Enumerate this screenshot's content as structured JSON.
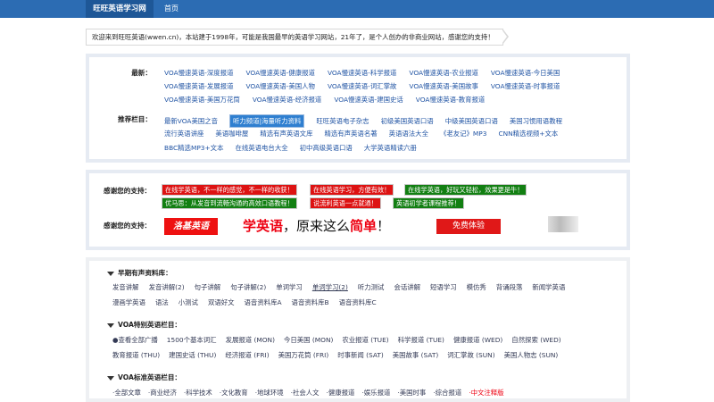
{
  "topbar": {
    "brand": "旺旺英语学习网",
    "home": "首页"
  },
  "welcome": "欢迎来到旺旺英语(wwen.cn)，本站建于1998年，可能是我国最早的英语学习网站，21年了，是个人创办的非商业网站，感谢您的支持！",
  "latest": {
    "label": "最新：",
    "rows": [
      [
        "VOA慢速英语-深度报道",
        "VOA慢速英语-健康报道",
        "VOA慢速英语-科学报道",
        "VOA慢速英语-农业报道",
        "VOA慢速英语-今日美国"
      ],
      [
        "VOA慢速英语-发展报道",
        "VOA慢速英语-美国人物",
        "VOA慢速英语-词汇掌故",
        "VOA慢速英语-美国故事",
        "VOA慢速英语-时事报道"
      ],
      [
        "VOA慢速英语-美国万花筒",
        "VOA慢速英语-经济报道",
        "VOA慢速英语-建国史话",
        "VOA慢速英语-教育报道"
      ]
    ]
  },
  "recommended": {
    "label": "推荐栏目：",
    "rows": [
      [
        "最新VOA美国之音",
        "听力频道|海量听力资料",
        "旺旺英语电子杂志",
        "初级美国英语口语",
        "中级美国英语口语",
        "美国习惯用语教程"
      ],
      [
        "流行英语讲座",
        "美语咖啡屋",
        "精选有声英语文库",
        "精选有声英语名著",
        "英语语法大全",
        "《老友记》MP3",
        "CNN精选视频+文本"
      ],
      [
        "BBC精选MP3+文本",
        "在线英语电台大全",
        "初中高级英语口语",
        "大学英语精读六册"
      ]
    ]
  },
  "support": {
    "label1": "感谢您的支持：",
    "badges_row1": [
      "在线学英语，不一样的感觉，不一样的收获！",
      "在线英语学习，方便有效！",
      "在线学英语，好玩又轻松，效果更是牛！"
    ],
    "badges_row2": [
      "优马思：从发音到流畅沟通的高效口语教程！",
      "说流利英语一点就通！",
      "英语初学者课程推荐！"
    ],
    "label2": "感谢您的支持：",
    "ad": {
      "logo": "洛基英语",
      "text_a": "学英语",
      "text_b": "，原来这么",
      "text_c": "简单",
      "text_d": "！",
      "button": "免费体验"
    }
  },
  "early": {
    "title": "早期有声资料库：",
    "rows": [
      [
        "发音讲解",
        "发音讲解(2)",
        "句子讲解",
        "句子讲解(2)",
        "单词学习",
        "单词学习(2)",
        "听力测试",
        "会话讲解",
        "短语学习",
        "模仿秀",
        "背诵段落",
        "新闻学英语"
      ],
      [
        "漫画学英语",
        "语法",
        "小测试",
        "双语好文",
        "语音资料库A",
        "语音资料库B",
        "语音资料库C"
      ]
    ]
  },
  "voa_special": {
    "title": "VOA特别英语栏目：",
    "rows": [
      [
        "●查看全部广播",
        "1500个基本词汇",
        "发展报道 (MON)",
        "今日美国 (MON)",
        "农业报道 (TUE)",
        "科学报道 (TUE)",
        "健康报道 (WED)",
        "自然探索 (WED)"
      ],
      [
        "教育报道 (THU)",
        "建国史话 (THU)",
        "经济报道 (FRI)",
        "美国万花筒 (FRI)",
        "时事新闻 (SAT)",
        "美国故事 (SAT)",
        "词汇掌故 (SUN)",
        "美国人物志 (SUN)"
      ]
    ]
  },
  "voa_standard": {
    "title": "VOA标准英语栏目：",
    "rows": [
      [
        "·全部文章",
        "·商业经济",
        "·科学技术",
        "·文化教育",
        "·地球环境",
        "·社会人文",
        "·健康报道",
        "·娱乐报道",
        "·美国时事",
        "·综合报道",
        "·中文注释版"
      ]
    ]
  },
  "colors": {
    "nav": "#2c6cb3",
    "brand": "#1e5797",
    "link": "#2255a4",
    "badge_red": "#dd1212",
    "badge_green": "#127f12",
    "panel_border": "#e6ebf3"
  }
}
